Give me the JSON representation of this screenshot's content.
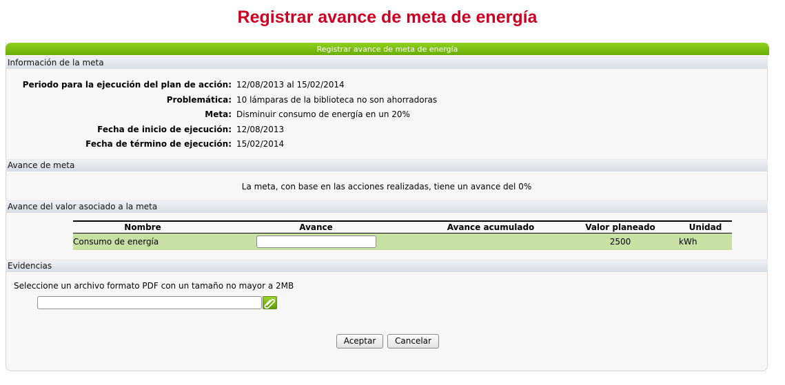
{
  "page_title": "Registrar avance de meta de energía",
  "panel_title": "Registrar avance de meta de energía",
  "sections": {
    "info": "Información de la meta",
    "avance": "Avance de meta",
    "valor": "Avance del valor asociado a la meta",
    "evidencias": "Evidencias"
  },
  "info_rows": [
    {
      "label": "Periodo para la ejecución del plan de acción:",
      "value": "12/08/2013 al 15/02/2014"
    },
    {
      "label": "Problemática:",
      "value": "10 lámparas de la biblioteca no son ahorradoras"
    },
    {
      "label": "Meta:",
      "value": "Disminuir consumo de energía en un 20%"
    },
    {
      "label": "Fecha de inicio de ejecución:",
      "value": "12/08/2013"
    },
    {
      "label": "Fecha de término de ejecución:",
      "value": "15/02/2014"
    }
  ],
  "progress_text": "La meta, con base en las acciones realizadas, tiene un avance del 0%",
  "table": {
    "headers": [
      "Nombre",
      "Avance",
      "Avance acumulado",
      "Valor planeado",
      "Unidad"
    ],
    "rows": [
      {
        "nombre": "Consumo de energía",
        "avance": "",
        "avance_acumulado": "",
        "valor_planeado": "2500",
        "unidad": "kWh"
      }
    ]
  },
  "file_hint": "Seleccione un archivo formato PDF con un tamaño no mayor a 2MB",
  "file_value": "",
  "buttons": {
    "accept": "Aceptar",
    "cancel": "Cancelar"
  },
  "icons": {
    "attach": "paperclip-icon"
  },
  "colors": {
    "title": "#cc0022",
    "header_green": "#7bbf12",
    "row_green": "#c7e0a4"
  }
}
